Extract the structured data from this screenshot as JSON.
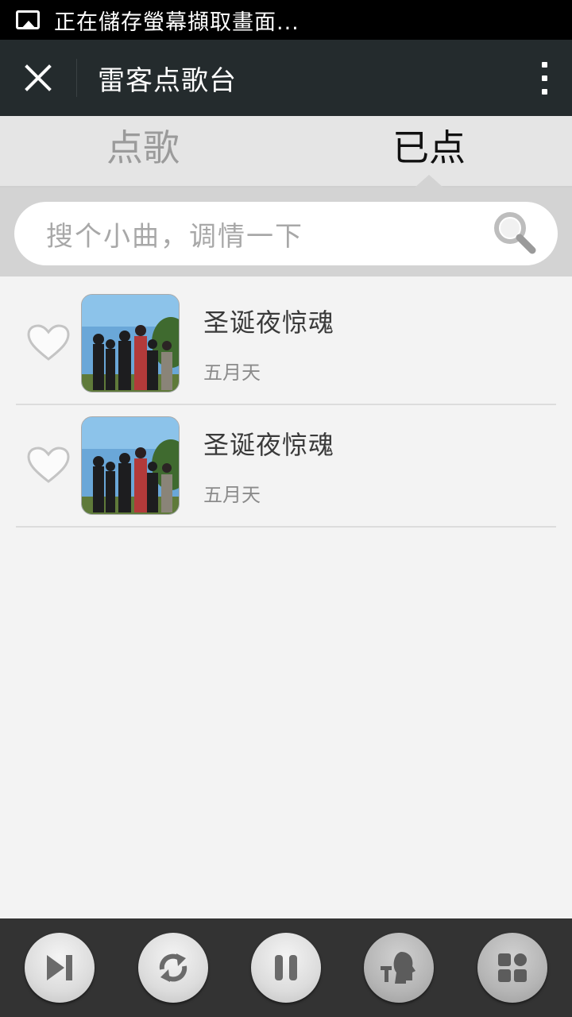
{
  "status_bar": {
    "text": "正在儲存螢幕擷取畫面..."
  },
  "title_bar": {
    "title": "雷客点歌台"
  },
  "tabs": [
    {
      "label": "点歌",
      "active": false
    },
    {
      "label": "已点",
      "active": true
    }
  ],
  "search": {
    "placeholder": "搜个小曲，调情一下"
  },
  "songs": [
    {
      "title": "圣诞夜惊魂",
      "artist": "五月天"
    },
    {
      "title": "圣诞夜惊魂",
      "artist": "五月天"
    }
  ],
  "controls": [
    {
      "icon": "skip-next-icon"
    },
    {
      "icon": "repeat-icon"
    },
    {
      "icon": "pause-icon"
    },
    {
      "icon": "singer-icon"
    },
    {
      "icon": "apps-icon"
    }
  ],
  "colors": {
    "title_bar": "#242b2d",
    "tabs_bg": "#e5e5e5",
    "bottom_bar": "#333333"
  }
}
